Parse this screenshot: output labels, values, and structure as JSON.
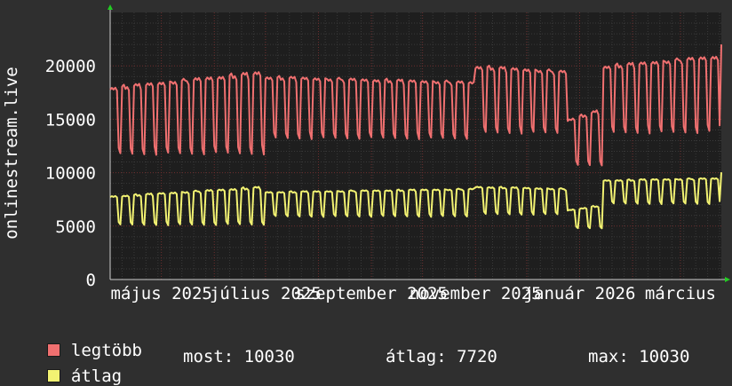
{
  "chart_data": {
    "type": "line",
    "ylabel": "onlinestream.live",
    "ylim": [
      0,
      25000
    ],
    "yticks": [
      0,
      5000,
      10000,
      15000,
      20000
    ],
    "xlim": [
      "2025-04-01",
      "2026-03-25"
    ],
    "xticks": [
      {
        "label": "május 2025",
        "date": "2025-05-01"
      },
      {
        "label": "július 2025",
        "date": "2025-07-01"
      },
      {
        "label": "szeptember 2025",
        "date": "2025-09-01"
      },
      {
        "label": "november 2025",
        "date": "2025-11-01"
      },
      {
        "label": "január 2026",
        "date": "2026-01-01"
      },
      {
        "label": "március",
        "date": "2026-03-01"
      }
    ],
    "grid": true,
    "colors": {
      "background": "#2f2f2f",
      "plot_bg": "#1e1e1e",
      "grid_minor": "#3a3a3a",
      "grid_major": "#6e2f2f",
      "axis_text": "#ffffff",
      "axis_arrow": "#22cc22"
    },
    "series": [
      {
        "name": "legtöbb",
        "color": "#f07070",
        "segments": [
          {
            "from": "2025-04-01",
            "to": "2025-07-01",
            "peak_start": 18000,
            "peak_end": 19500,
            "trough": 11500
          },
          {
            "from": "2025-07-01",
            "to": "2025-11-01",
            "peak_start": 19000,
            "peak_end": 18500,
            "trough": 13000
          },
          {
            "from": "2025-11-01",
            "to": "2025-12-25",
            "peak_start": 20000,
            "peak_end": 19500,
            "trough": 13500
          },
          {
            "from": "2025-12-25",
            "to": "2026-01-15",
            "peak_start": 15000,
            "peak_end": 16000,
            "trough": 10500
          },
          {
            "from": "2026-01-15",
            "to": "2026-03-25",
            "peak_start": 20000,
            "peak_end": 21000,
            "trough": 13500
          }
        ],
        "last_value": 22000
      },
      {
        "name": "átlag",
        "color": "#f2f272",
        "segments": [
          {
            "from": "2025-04-01",
            "to": "2025-07-01",
            "peak_start": 7800,
            "peak_end": 8700,
            "trough": 5000
          },
          {
            "from": "2025-07-01",
            "to": "2025-11-01",
            "peak_start": 8200,
            "peak_end": 8500,
            "trough": 5800
          },
          {
            "from": "2025-11-01",
            "to": "2025-12-25",
            "peak_start": 8700,
            "peak_end": 8500,
            "trough": 6000
          },
          {
            "from": "2025-12-25",
            "to": "2026-01-15",
            "peak_start": 6500,
            "peak_end": 7000,
            "trough": 4700
          },
          {
            "from": "2026-01-15",
            "to": "2026-03-25",
            "peak_start": 9300,
            "peak_end": 9500,
            "trough": 7000
          }
        ],
        "last_value": 10030
      }
    ]
  },
  "legend": {
    "max_label": "legtöbb",
    "avg_label": "átlag"
  },
  "stats": {
    "now": "most: 10030",
    "avg": "átlag: 7720",
    "max": "max: 10030"
  }
}
